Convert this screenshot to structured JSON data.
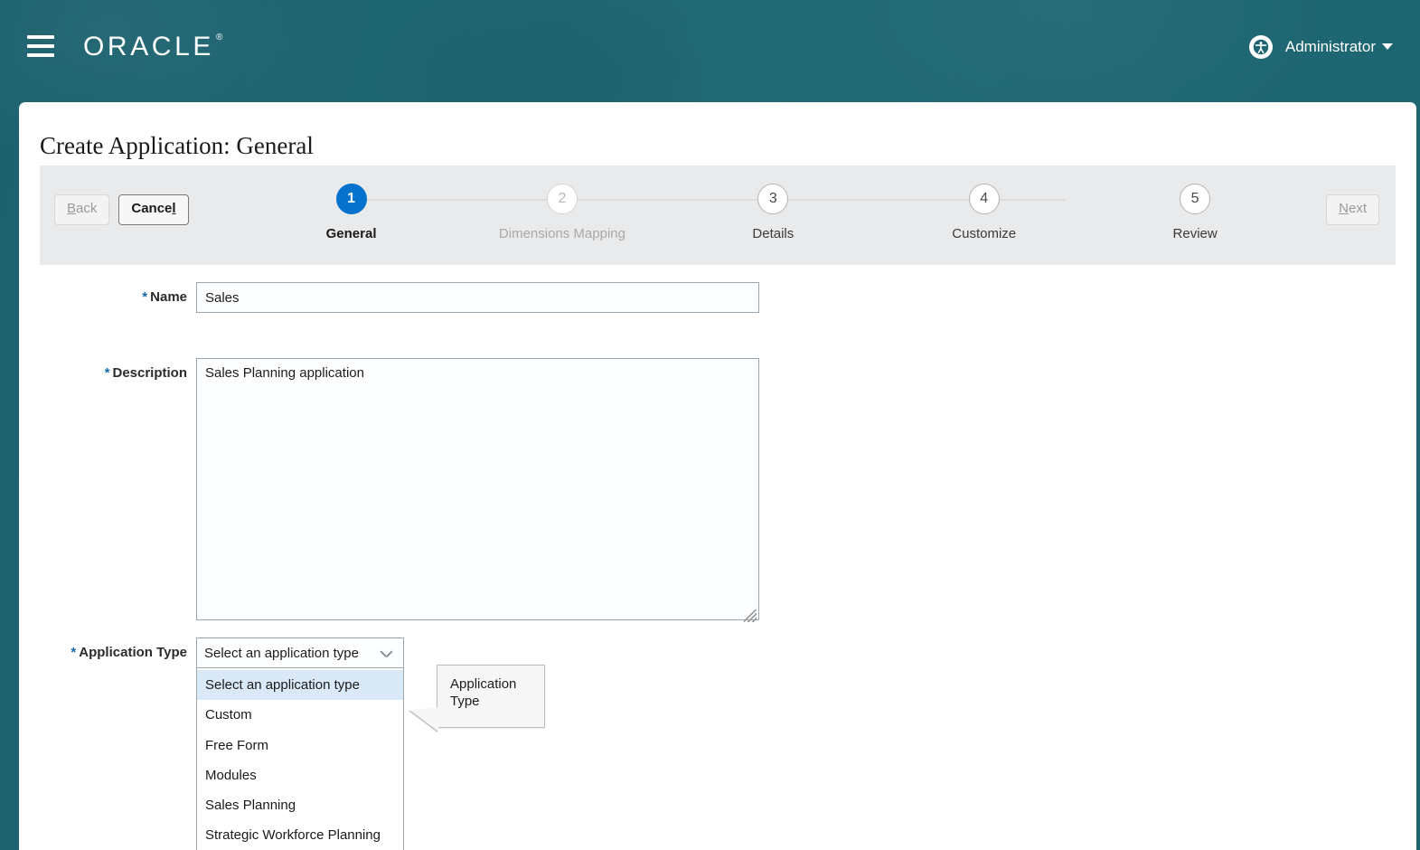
{
  "header": {
    "menu_icon": "hamburger-menu-icon",
    "brand": "ORACLE",
    "brand_mark": "®",
    "accessibility_icon": "accessibility-person-icon",
    "user_label": "Administrator",
    "user_caret_icon": "chevron-down-icon",
    "background_color": "#1e6471"
  },
  "page": {
    "title": "Create Application: General"
  },
  "toolbar": {
    "back_label": "Back",
    "back_accesskey": "B",
    "back_disabled": true,
    "cancel_label": "Cance",
    "cancel_accesskey": "l",
    "cancel_disabled": false,
    "next_label": "ext",
    "next_accesskey": "N",
    "next_disabled": true,
    "band_color": "#e9eaeb"
  },
  "train": {
    "active_color": "#0572ce",
    "steps": [
      {
        "number": "1",
        "label": "General",
        "state": "active"
      },
      {
        "number": "2",
        "label": "Dimensions Mapping",
        "state": "disabled"
      },
      {
        "number": "3",
        "label": "Details",
        "state": "normal"
      },
      {
        "number": "4",
        "label": "Customize",
        "state": "normal"
      },
      {
        "number": "5",
        "label": "Review",
        "state": "normal"
      }
    ]
  },
  "form": {
    "required_marker": "*",
    "name": {
      "label": "Name",
      "value": "Sales",
      "placeholder": ""
    },
    "description": {
      "label": "Description",
      "value": "Sales Planning application",
      "placeholder": ""
    },
    "application_type": {
      "label": "Application Type",
      "selected": "Select an application type",
      "chevron_icon": "chevron-down-icon",
      "options": [
        "Select an application type",
        "Custom",
        "Free Form",
        "Modules",
        "Sales Planning",
        "Strategic Workforce Planning"
      ],
      "highlighted_index": 0
    }
  },
  "tooltip": {
    "text": "Application Type"
  }
}
